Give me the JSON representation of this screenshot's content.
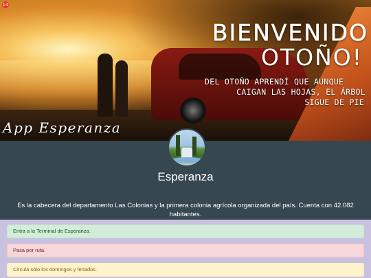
{
  "notification": {
    "count": "14"
  },
  "banner": {
    "title_line1": "BIENVENIDO",
    "title_line2": "OTOÑO!",
    "tagline_line1": "DEL OTOÑO APRENDÍ QUE AUNQUE",
    "tagline_line2": "CAIGAN LAS HOJAS, EL ÁRBOL",
    "tagline_line3": "SIGUE DE PIE",
    "app_name": "App Esperanza"
  },
  "profile": {
    "city": "Esperanza",
    "description": "Es la cabecera del departamento Las Colonias y la primera colonia agrícola organizada del país. Cuenta con 42.082 habitantes."
  },
  "alerts": [
    {
      "text": "Entra a la Terminal de Esperanza.",
      "color": "#d4edda"
    },
    {
      "text": "Pasa por ruta.",
      "color": "#f8d7da"
    },
    {
      "text": "Circula sólo los domingos y feriados.",
      "color": "#fff3cd"
    }
  ]
}
